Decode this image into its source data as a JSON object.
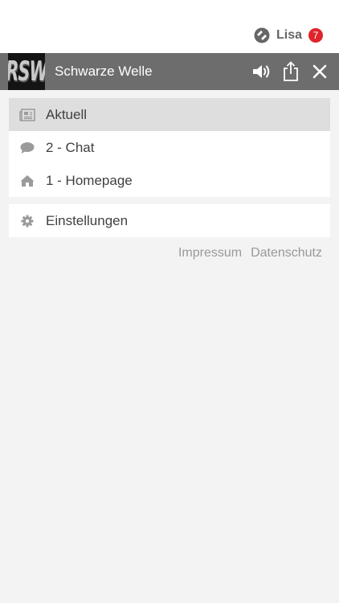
{
  "user": {
    "name": "Lisa",
    "badge_count": "7",
    "logo_icon": "phonostar-logo-icon"
  },
  "station": {
    "logo_text": "RSW",
    "title": "Schwarze Welle",
    "actions": [
      "volume-icon",
      "share-icon",
      "close-icon"
    ]
  },
  "menu": {
    "items": [
      {
        "label": "Aktuell",
        "icon": "newspaper-icon",
        "active": true
      },
      {
        "label": "2 - Chat",
        "icon": "chat-bubble-icon",
        "active": false
      },
      {
        "label": "1 - Homepage",
        "icon": "home-icon",
        "active": false
      }
    ]
  },
  "settings": {
    "label": "Einstellungen",
    "icon": "gear-icon"
  },
  "footer": {
    "impressum": "Impressum",
    "datenschutz": "Datenschutz"
  },
  "colors": {
    "header_bg": "#6d6d6d",
    "badge": "#e0242b",
    "active_item": "#dedede",
    "content_bg": "#f3f3f3"
  }
}
